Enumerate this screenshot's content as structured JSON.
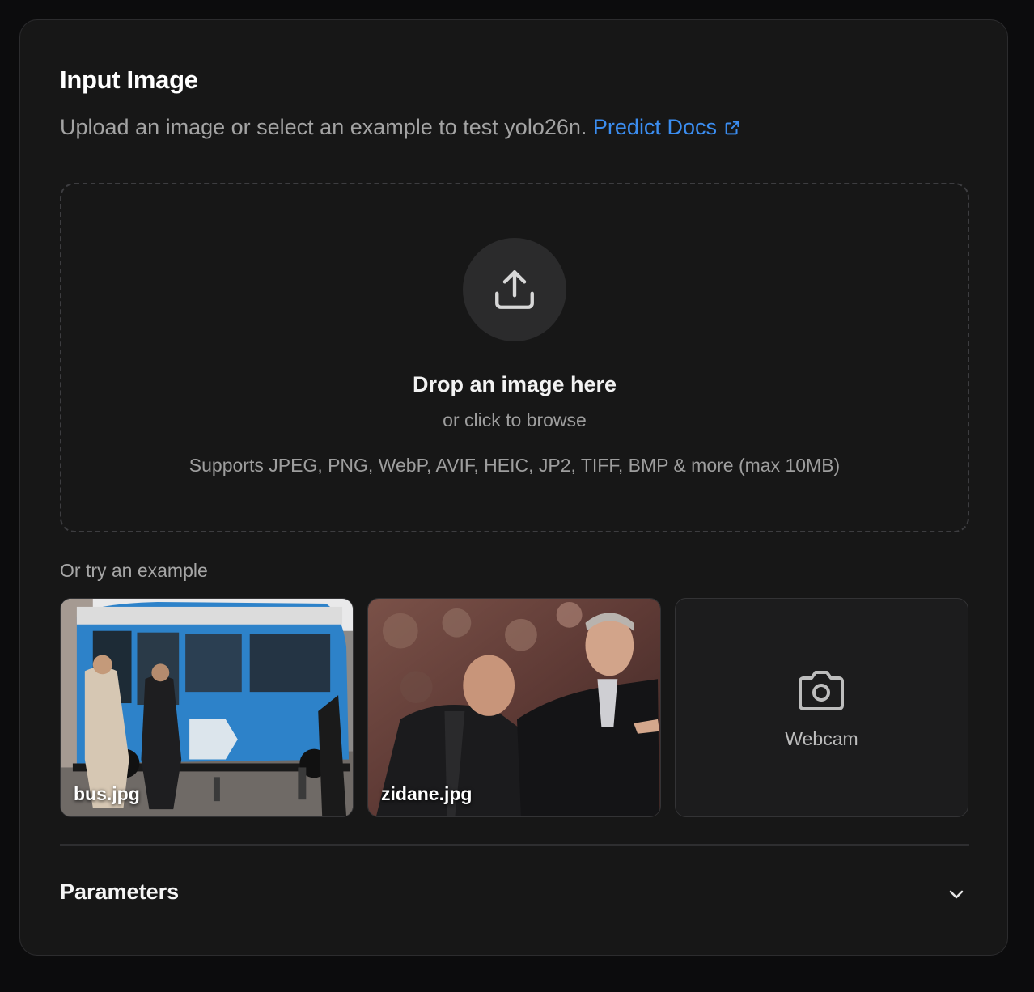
{
  "card": {
    "title": "Input Image",
    "subtitle_text": "Upload an image or select an example to test yolo26n.",
    "docs_link_label": "Predict Docs"
  },
  "dropzone": {
    "icon": "upload-icon",
    "title": "Drop an image here",
    "subtitle": "or click to browse",
    "formats": "Supports JPEG, PNG, WebP, AVIF, HEIC, JP2, TIFF, BMP & more (max 10MB)"
  },
  "examples": {
    "label": "Or try an example",
    "items": [
      {
        "label": "bus.jpg"
      },
      {
        "label": "zidane.jpg"
      },
      {
        "label": "Webcam",
        "icon": "camera-icon"
      }
    ]
  },
  "parameters": {
    "title": "Parameters",
    "icon": "chevron-down-icon"
  },
  "colors": {
    "background": "#0c0c0d",
    "card": "#171717",
    "accent_link": "#3b8df0"
  }
}
